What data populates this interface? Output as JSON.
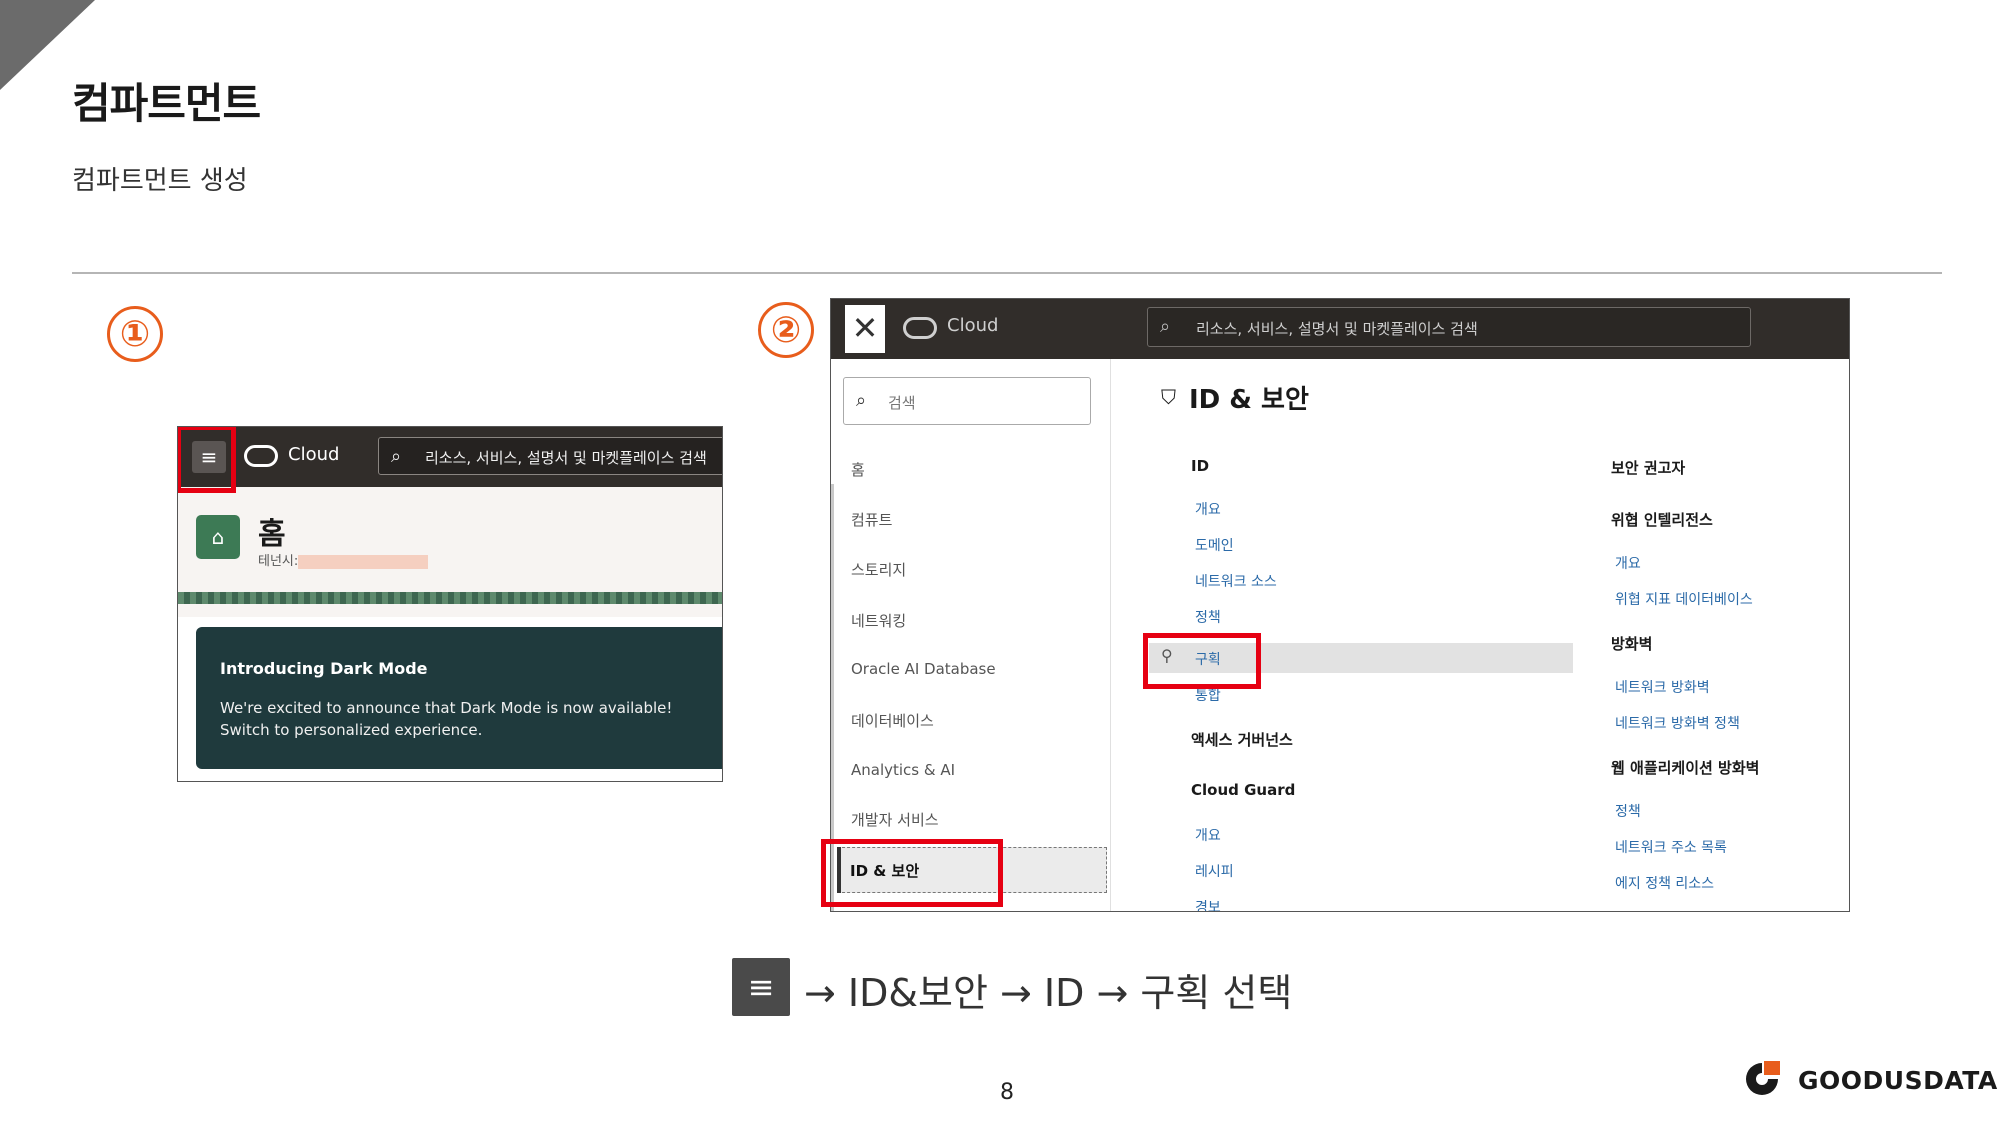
{
  "header": {
    "title": "컴파트먼트",
    "subtitle": "컴파트먼트 생성"
  },
  "steps": [
    "①",
    "②"
  ],
  "screenshot1": {
    "menu_icon": "hamburger-menu-icon",
    "brand": "Cloud",
    "search_placeholder": "리소스, 서비스, 설명서 및 마켓플레이스 검색",
    "home_title": "홈",
    "tenancy_label": "테넌시:",
    "card_title": "Introducing Dark Mode",
    "card_body": "We're excited to announce that Dark Mode is now available! Switch to personalized experience."
  },
  "screenshot2": {
    "brand": "Cloud",
    "search_placeholder": "리소스, 서비스, 설명서 및 마켓플레이스 검색",
    "side_search_placeholder": "검색",
    "nav_items": [
      "홈",
      "컴퓨트",
      "스토리지",
      "네트워킹",
      "Oracle AI Database",
      "데이터베이스",
      "Analytics & AI",
      "개발자 서비스"
    ],
    "nav_selected": "ID & 보안",
    "section_title": "ID & 보안",
    "col1": {
      "heading": "ID",
      "links": [
        "개요",
        "도메인",
        "네트워크 소스",
        "정책",
        "구획",
        "통합"
      ],
      "heading2": "액세스 거버넌스",
      "heading3": "Cloud Guard",
      "links3": [
        "개요",
        "레시피",
        "경보"
      ]
    },
    "col2": {
      "heading1": "보안 권고자",
      "heading2": "위협 인텔리전스",
      "links2": [
        "개요",
        "위협 지표 데이터베이스"
      ],
      "heading3": "방화벽",
      "links3": [
        "네트워크 방화벽",
        "네트워크 방화벽 정책"
      ],
      "heading4": "웹 애플리케이션 방화벽",
      "links4": [
        "정책",
        "네트워크 주소 목록",
        "에지 정책 리소스"
      ]
    }
  },
  "instruction": {
    "icon": "hamburger-menu-icon",
    "text": "→ ID&보안 → ID → 구획 선택"
  },
  "footer": {
    "page_number": "8",
    "brand_name": "GOODUSDATA"
  },
  "colors": {
    "accent_orange": "#e85d1c",
    "highlight_red": "#e60012",
    "oracle_bar": "#312d2a",
    "link_blue": "#2b6aa8"
  }
}
